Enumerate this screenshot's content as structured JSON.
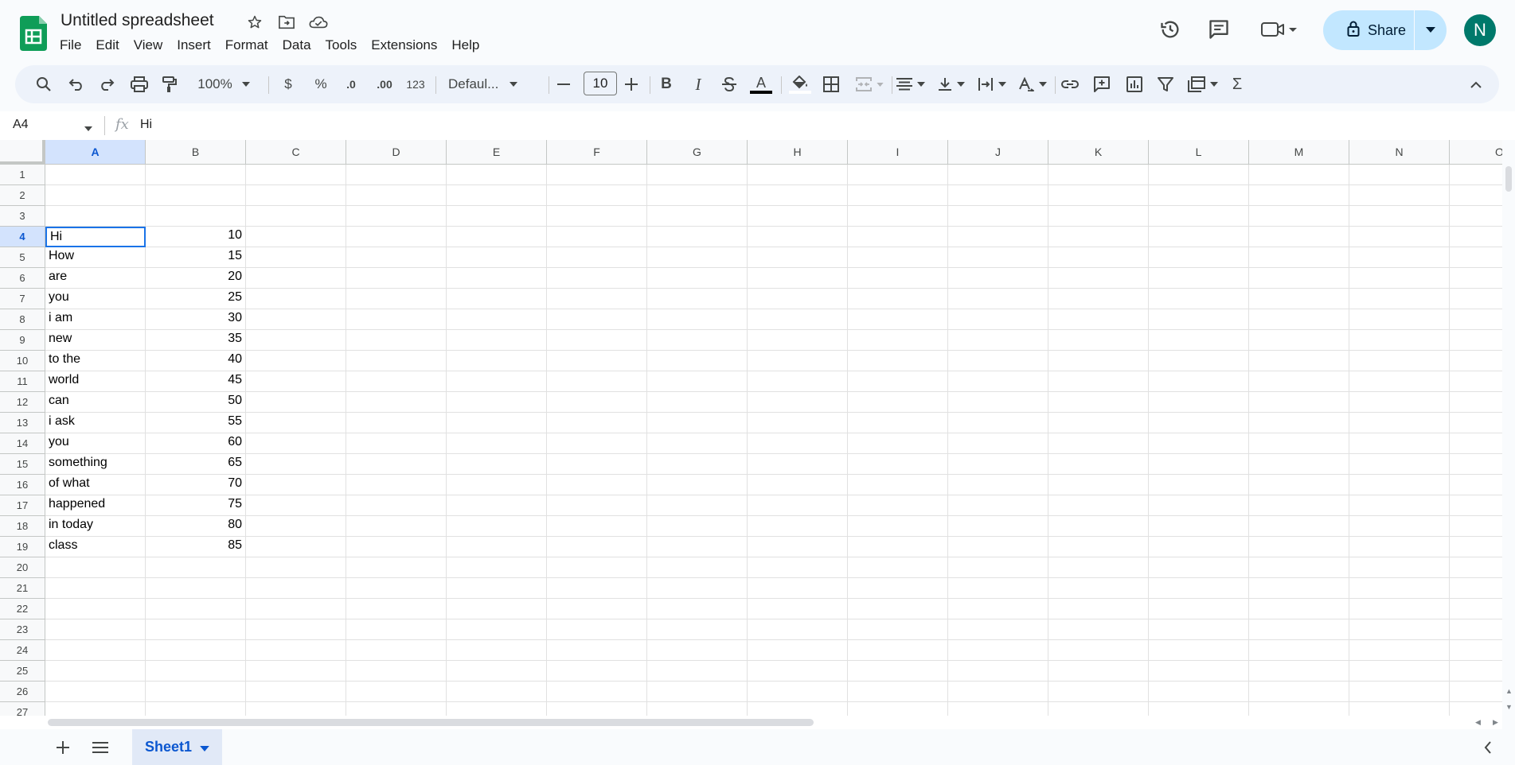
{
  "app": {
    "title": "Untitled spreadsheet",
    "menu": [
      "File",
      "Edit",
      "View",
      "Insert",
      "Format",
      "Data",
      "Tools",
      "Extensions",
      "Help"
    ],
    "share_label": "Share",
    "avatar_initial": "N",
    "brand_color": "#0f9d58"
  },
  "toolbar": {
    "zoom": "100%",
    "currency": "$",
    "percent": "%",
    "decrease_decimal": ".0",
    "increase_decimal": ".00",
    "more_formats": "123",
    "font": "Defaul...",
    "font_size": "10"
  },
  "formula_bar": {
    "cell_ref": "A4",
    "value": "Hi"
  },
  "grid": {
    "columns": [
      "A",
      "B",
      "C",
      "D",
      "E",
      "F",
      "G",
      "H",
      "I",
      "J",
      "K",
      "L",
      "M",
      "N",
      "O"
    ],
    "row_numbers": [
      "1",
      "2",
      "3",
      "4",
      "5",
      "6",
      "7",
      "8",
      "9",
      "10",
      "11",
      "12",
      "13",
      "14",
      "15",
      "16",
      "17",
      "18",
      "19",
      "20",
      "21",
      "22",
      "23",
      "24",
      "25",
      "26",
      "27"
    ],
    "selected_cell": "A4",
    "rows": [
      {
        "row": 4,
        "a": "Hi",
        "b": "10"
      },
      {
        "row": 5,
        "a": "How",
        "b": "15"
      },
      {
        "row": 6,
        "a": "are",
        "b": "20"
      },
      {
        "row": 7,
        "a": "you",
        "b": "25"
      },
      {
        "row": 8,
        "a": "i am",
        "b": "30"
      },
      {
        "row": 9,
        "a": "new",
        "b": "35"
      },
      {
        "row": 10,
        "a": "to the",
        "b": "40"
      },
      {
        "row": 11,
        "a": "world",
        "b": "45"
      },
      {
        "row": 12,
        "a": "can",
        "b": "50"
      },
      {
        "row": 13,
        "a": "i ask",
        "b": "55"
      },
      {
        "row": 14,
        "a": "you",
        "b": "60"
      },
      {
        "row": 15,
        "a": "something",
        "b": "65"
      },
      {
        "row": 16,
        "a": "of what",
        "b": "70"
      },
      {
        "row": 17,
        "a": "happened",
        "b": "75"
      },
      {
        "row": 18,
        "a": "in today",
        "b": "80"
      },
      {
        "row": 19,
        "a": "class",
        "b": "85"
      }
    ]
  },
  "sheets": {
    "tabs": [
      "Sheet1"
    ]
  }
}
